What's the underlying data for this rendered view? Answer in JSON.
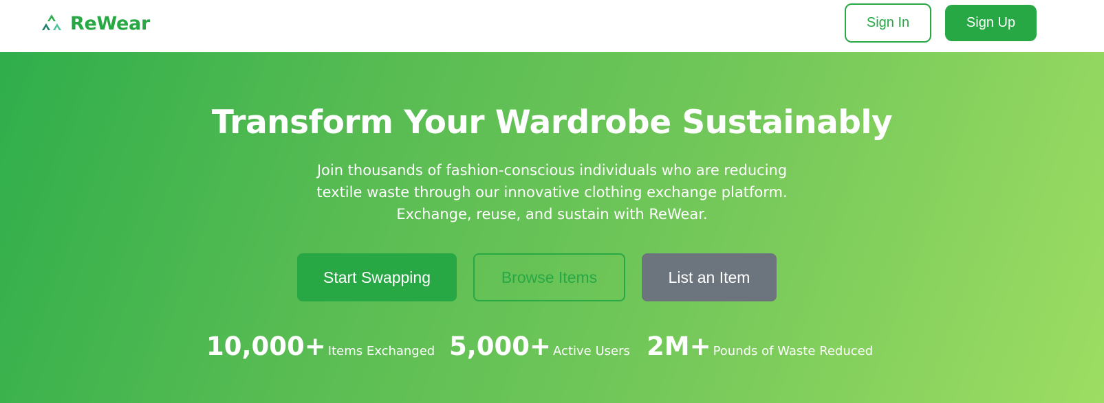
{
  "brand": {
    "name": "ReWear",
    "icon": "recycle-icon",
    "color": "#28a745"
  },
  "nav": {
    "sign_in_label": "Sign In",
    "sign_up_label": "Sign Up"
  },
  "hero": {
    "title": "Transform Your Wardrobe Sustainably",
    "subtitle_lines": [
      "Join thousands of fashion-conscious individuals who are reducing",
      "textile waste through our innovative clothing exchange platform.",
      "Exchange, reuse, and sustain with ReWear."
    ],
    "buttons": {
      "start_swapping": "Start Swapping",
      "browse_items": "Browse Items",
      "list_item": "List an Item"
    },
    "stats": [
      {
        "value": "10,000+",
        "label": "Items Exchanged"
      },
      {
        "value": "5,000+",
        "label": "Active Users"
      },
      {
        "value": "2M+",
        "label": "Pounds of Waste Reduced"
      }
    ]
  },
  "colors": {
    "primary": "#28a745",
    "secondary": "#6c757d",
    "gradient_start": "#2fae4b",
    "gradient_end": "#9ddd63"
  }
}
